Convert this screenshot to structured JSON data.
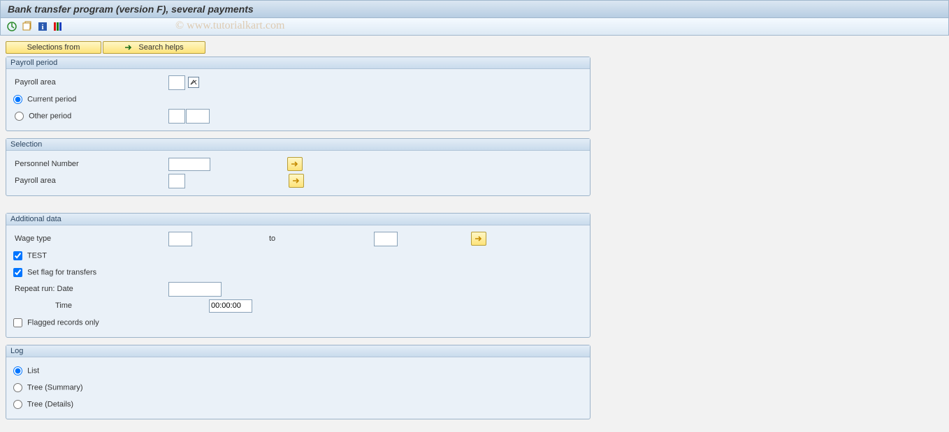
{
  "header": {
    "title": "Bank transfer program (version F), several payments"
  },
  "watermark": "© www.tutorialkart.com",
  "buttons": {
    "selections_from": "Selections from",
    "search_helps": "Search helps"
  },
  "payroll_period": {
    "title": "Payroll period",
    "payroll_area_label": "Payroll area",
    "current_period_label": "Current period",
    "other_period_label": "Other period"
  },
  "selection": {
    "title": "Selection",
    "personnel_number_label": "Personnel Number",
    "payroll_area_label": "Payroll area"
  },
  "additional": {
    "title": "Additional data",
    "wage_type_label": "Wage type",
    "to_label": "to",
    "test_label": "TEST",
    "set_flag_label": "Set flag for transfers",
    "repeat_date_label": "Repeat run: Date",
    "time_label": "Time",
    "time_value": "00:00:00",
    "flagged_only_label": "Flagged records only"
  },
  "log": {
    "title": "Log",
    "list_label": "List",
    "tree_summary_label": "Tree (Summary)",
    "tree_details_label": "Tree (Details)"
  }
}
